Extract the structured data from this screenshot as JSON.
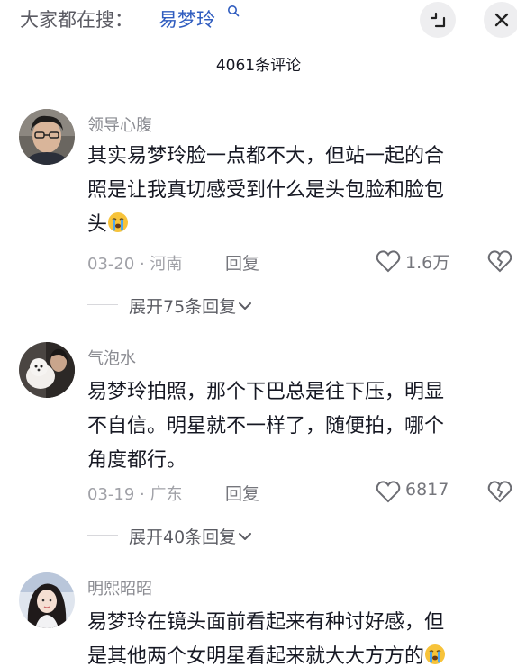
{
  "header": {
    "search_prefix": "大家都在搜：",
    "search_query": "易梦玲",
    "search_icon": "search-icon",
    "expand_icon": "collapse-icon",
    "close_icon": "close-icon"
  },
  "comment_count": "4061条评论",
  "comments": [
    {
      "username": "领导心腹",
      "line1": "其实易梦玲脸一点都不大，但站一起的合",
      "line2": "照是让我真切感受到什么是头包脸和脸包",
      "line3": "头",
      "emoji": "crying-emoji",
      "meta": "03-20 · 河南",
      "reply": "回复",
      "likes": "1.6万",
      "expand": "展开75条回复"
    },
    {
      "username": "气泡水",
      "line1": "易梦玲拍照，那个下巴总是往下压，明显",
      "line2": "不自信。明星就不一样了，随便拍，哪个",
      "line3": "角度都行。",
      "meta": "03-19 · 广东",
      "reply": "回复",
      "likes": "6817",
      "expand": "展开40条回复"
    },
    {
      "username": "明熙昭昭",
      "line1": "易梦玲在镜头面前看起来有种讨好感，但",
      "line2": "是其他两个女明星看起来就大大方方的",
      "emoji": "crying-emoji"
    }
  ],
  "colors": {
    "accent_blue": "#2f5cbf",
    "text_primary": "#161823",
    "text_secondary": "#8a8b91"
  }
}
